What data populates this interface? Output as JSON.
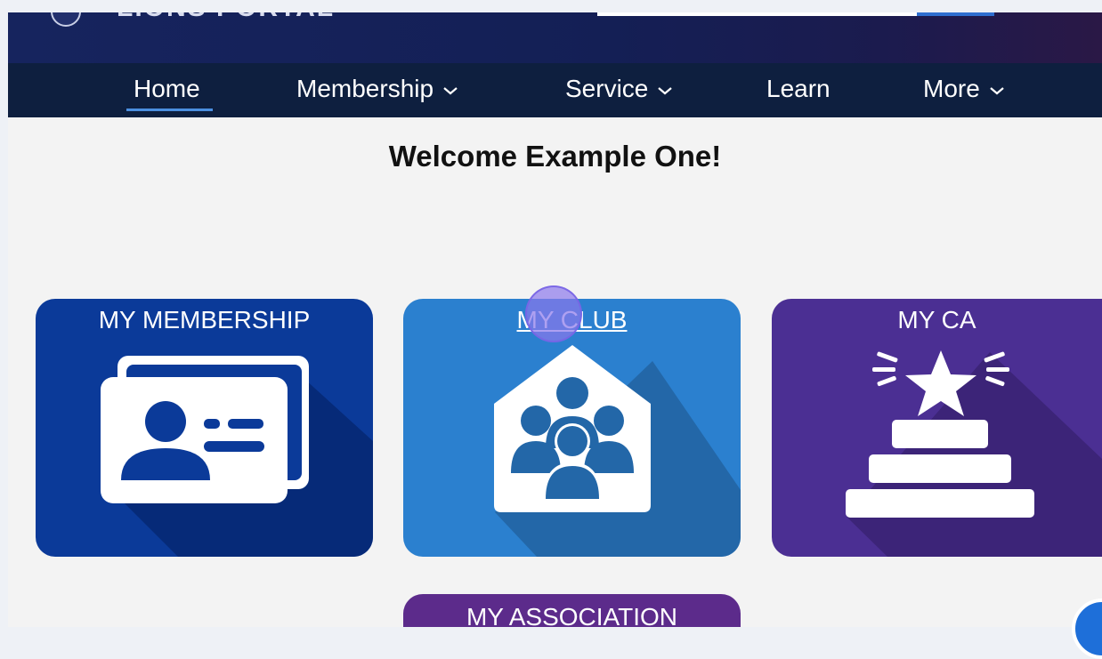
{
  "header": {
    "logo_text": "LIONS PORTAL"
  },
  "nav": {
    "items": [
      {
        "label": "Home",
        "has_dropdown": false,
        "active": true
      },
      {
        "label": "Membership",
        "has_dropdown": true
      },
      {
        "label": "Service",
        "has_dropdown": true
      },
      {
        "label": "Learn",
        "has_dropdown": false
      },
      {
        "label": "More",
        "has_dropdown": true
      }
    ]
  },
  "welcome": "Welcome Example One!",
  "tiles": [
    {
      "title": "MY MEMBERSHIP",
      "icon": "id-cards-icon",
      "color": "#0b3a99"
    },
    {
      "title": "MY CLUB",
      "icon": "club-house-people-icon",
      "color": "#2b80cf"
    },
    {
      "title": "MY CA",
      "icon": "star-podium-icon",
      "color": "#4b2f93"
    },
    {
      "title": "MY ASSOCIATION",
      "icon": "",
      "color": "#5c2b8b"
    }
  ],
  "colors": {
    "nav_bg": "#0e1f3f",
    "accent": "#4b8fe0",
    "page_bg": "#f3f3f3"
  }
}
